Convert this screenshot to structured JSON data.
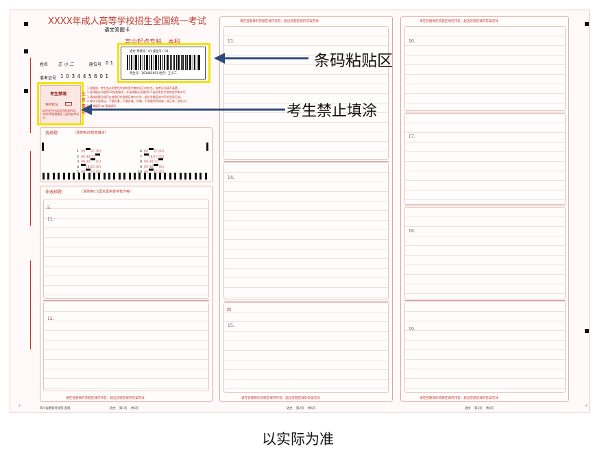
{
  "sheet": {
    "title": "XXXX年成人高等学校招生全国统一考试",
    "subtitle": "语文答题卡",
    "level": "高中起点专科、本科",
    "name_label": "姓名",
    "name_value": "王 小 二",
    "seat_label": "座位号",
    "seat_value": "0 1",
    "exam_no_label": "准考证号",
    "exam_no_digits": [
      "1",
      "0",
      "3",
      "4",
      "4",
      "5",
      "6",
      "0",
      "1"
    ],
    "barcode": {
      "line1": "语文 考场号：01   座位号：01",
      "line2": "考生号：103445601  姓名：王小二"
    },
    "forbidden_box": {
      "title": "考生禁填",
      "missing_mark": "缺考标记",
      "note": "缺考考生由监考员贴条形码，并用2B铅笔填涂上面的缺考标记。"
    },
    "notes": {
      "label": "注意事项",
      "items": [
        "1.答题前，考生务必用黑色字迹的签字笔将自己的姓名、准考证号填写清楚。",
        "2.选择题必须使用2B铅笔填涂；非选择题必须使用0.5毫米黑色字迹的签字笔书写。",
        "3.请按照题号顺序在各题目的答题区域内作答，超出答题区域书写的答案无效。",
        "4.保持卡面清洁，不要折叠、不要弄破、弄皱，不准使用涂改液、修正带、刮纸刀。",
        "5.正确填涂 ▬ 错误填涂"
      ]
    },
    "choice_section": {
      "title": "选择题",
      "hint": "（请使用2B铅笔填涂）",
      "left_numbers": [
        "1",
        "2",
        "3",
        "4",
        "5"
      ],
      "right_numbers": [
        "6",
        "7",
        "8",
        "9",
        "10"
      ],
      "options": [
        "A",
        "B",
        "C",
        "D"
      ]
    },
    "nonchoice_section": {
      "title": "非选择题",
      "hint": "（请使用0.5毫米黑色签字笔作答）",
      "section_three": "三",
      "section_four": "四"
    },
    "answer_hint": "请在各题目的答题区域内作答，超出答题区域的答案无效",
    "questions": {
      "q11": "11.",
      "q12": "12.",
      "q13": "13.",
      "q14": "14.",
      "q15": "15.",
      "q16": "16.",
      "q17": "17.",
      "q18": "18.",
      "q19": "19."
    },
    "footers": {
      "left": "四川省教育考试院  监制",
      "page1": "语文    第1页    共6页",
      "page2": "语文    第2页    共6页",
      "page3": "语文    第3页    共6页"
    }
  },
  "annotations": {
    "barcode_area": "条码粘贴区",
    "no_fill": "考生禁止填涂",
    "caption": "以实际为准"
  },
  "colors": {
    "accent_red": "#c0392b",
    "highlight_yellow": "#f4e200",
    "arrow_navy": "#2e4a7a"
  }
}
